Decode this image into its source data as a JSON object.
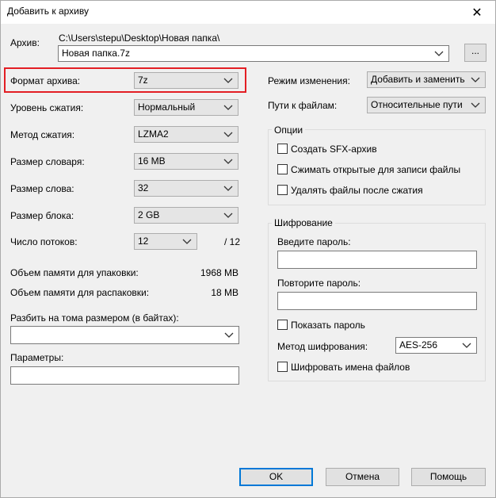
{
  "window": {
    "title": "Добавить к архиву",
    "close_glyph": "✕"
  },
  "archive": {
    "label": "Архив:",
    "path": "C:\\Users\\stepu\\Desktop\\Новая папка\\",
    "filename": "Новая папка.7z",
    "browse_label": "..."
  },
  "left": {
    "format_label": "Формат архива:",
    "format_value": "7z",
    "level_label": "Уровень сжатия:",
    "level_value": "Нормальный",
    "method_label": "Метод сжатия:",
    "method_value": "LZMA2",
    "dict_label": "Размер словаря:",
    "dict_value": "16 MB",
    "word_label": "Размер слова:",
    "word_value": "32",
    "block_label": "Размер блока:",
    "block_value": "2 GB",
    "threads_label": "Число потоков:",
    "threads_value": "12",
    "threads_max": "/ 12",
    "mem_pack_label": "Объем памяти для упаковки:",
    "mem_pack_value": "1968 MB",
    "mem_unpack_label": "Объем памяти для распаковки:",
    "mem_unpack_value": "18 MB",
    "split_label": "Разбить на тома размером (в байтах):",
    "split_value": "",
    "params_label": "Параметры:",
    "params_value": ""
  },
  "right": {
    "update_label": "Режим изменения:",
    "update_value": "Добавить и заменить",
    "paths_label": "Пути к файлам:",
    "paths_value": "Относительные пути",
    "options": {
      "title": "Опции",
      "sfx": "Создать SFX-архив",
      "shared": "Сжимать открытые для записи файлы",
      "delete": "Удалять файлы после сжатия"
    },
    "encryption": {
      "title": "Шифрование",
      "enter_password": "Введите пароль:",
      "repeat_password": "Повторите пароль:",
      "show_password": "Показать пароль",
      "method_label": "Метод шифрования:",
      "method_value": "AES-256",
      "encrypt_names": "Шифровать имена файлов"
    }
  },
  "buttons": {
    "ok": "OK",
    "cancel": "Отмена",
    "help": "Помощь"
  }
}
